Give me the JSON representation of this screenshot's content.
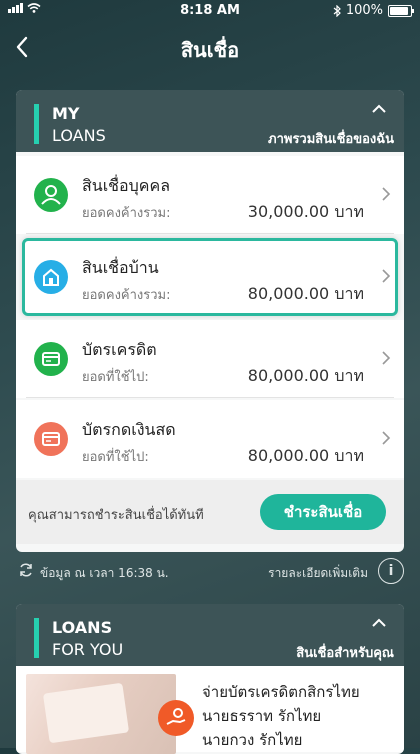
{
  "status": {
    "time": "8:18 AM",
    "battery": "100%"
  },
  "nav": {
    "title": "สินเชื่อ"
  },
  "my_loans": {
    "title_line1": "MY",
    "title_line2": "LOANS",
    "overview_link": "ภาพรวมสินเชื่อของฉัน",
    "items": [
      {
        "name": "สินเชื่อบุคคล",
        "label": "ยอดคงค้างรวม:",
        "amount": "30,000.00 บาท",
        "icon": "person-icon",
        "color": "#22b24c"
      },
      {
        "name": "สินเชื่อบ้าน",
        "label": "ยอดคงค้างรวม:",
        "amount": "80,000.00 บาท",
        "icon": "home-icon",
        "color": "#27aee6"
      },
      {
        "name": "บัตรเครดิต",
        "label": "ยอดที่ใช้ไป:",
        "amount": "80,000.00 บาท",
        "icon": "credit-card-icon",
        "color": "#22b24c"
      },
      {
        "name": "บัตรกดเงินสด",
        "label": "ยอดที่ใช้ไป:",
        "amount": "80,000.00 บาท",
        "icon": "cash-card-icon",
        "color": "#f0735a"
      }
    ],
    "pay_text": "คุณสามารถชำระสินเชื่อได้ทันที",
    "pay_button": "ชำระสินเชื่อ"
  },
  "info": {
    "updated": "ข้อมูล ณ เวลา 16:38 น.",
    "more": "รายละเอียดเพิ่มเติม",
    "info_icon": "i"
  },
  "loans_for_you": {
    "title_line1": "LOANS",
    "title_line2": "FOR YOU",
    "link": "สินเชื่อสำหรับคุณ",
    "promo_lines": [
      "จ่ายบัตรเครดิตกสิกรไทย",
      "นายธรราท รักไทย",
      "นายกวง รักไทย"
    ]
  }
}
